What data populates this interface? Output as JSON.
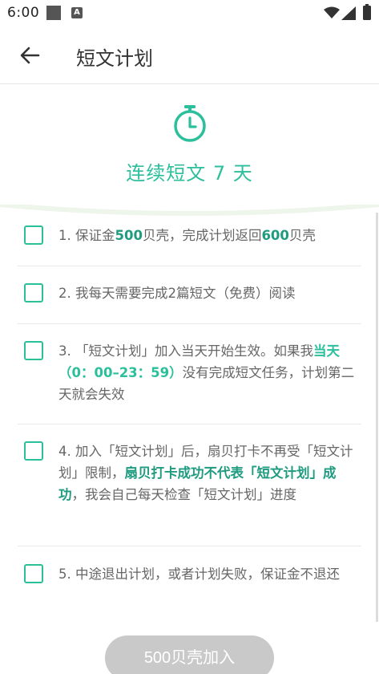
{
  "status_bar": {
    "time": "6:00",
    "a_badge": "A"
  },
  "app_bar": {
    "title": "短文计划"
  },
  "header": {
    "streak_title": "连续短文 7 天"
  },
  "rules": [
    {
      "n": "1. ",
      "a": "保证金",
      "b": "500",
      "c": "贝壳，完成计划返回",
      "d": "600",
      "e": "贝壳"
    },
    {
      "text": "2. 我每天需要完成2篇短文（免费）阅读"
    },
    {
      "a": "3. 「短文计划」加入当天开始生效。如果我",
      "b": "当天（0：00–23：59）",
      "c": "没有完成短文任务，计划第二天就会失效"
    },
    {
      "a": "4. 加入「短文计划」后，扇贝打卡不再受「短文计划」限制，",
      "b": "扇贝打卡成功不代表「短文计划」成功",
      "c": "，我会自己每天检查「短文计划」进度"
    },
    {
      "text": "5. 中途退出计划，或者计划失败，保证金不退还"
    }
  ],
  "join_button": {
    "label": "500贝壳加入"
  },
  "colors": {
    "accent": "#2bbf9c",
    "button_disabled": "#c9c9c9"
  }
}
